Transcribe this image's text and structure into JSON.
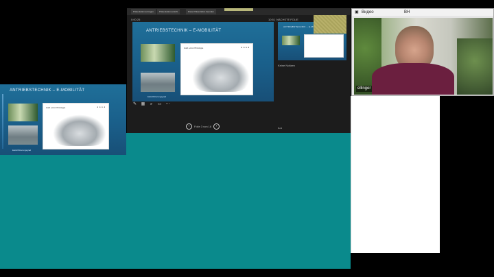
{
  "slide": {
    "title": "ANTRIEBSTECHNIK – E-MOBILITÄT",
    "card_title": "Audi e-tron Prototype",
    "footer": "Elektrifizierungsgrad"
  },
  "ppt": {
    "tabs": [
      "Präsentation anzeigen",
      "Präsentation ansicht",
      "Diese Präsentation beenden"
    ],
    "timer": "0:00:25",
    "clock": "10:51",
    "next_slide_label": "NÄCHSTE FOLIE",
    "notes": "Keine Notizen",
    "slide_counter": "Folie 3 von 18"
  },
  "video": {
    "window_title": "Видео",
    "corner_label": "ВН",
    "participant_name": "ellinger"
  }
}
